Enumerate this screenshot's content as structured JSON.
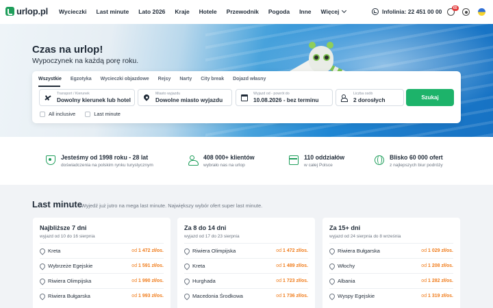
{
  "header": {
    "logo_text": "urlop.pl",
    "nav": [
      "Wycieczki",
      "Last minute",
      "Lato 2026",
      "Kraje",
      "Hotele",
      "Przewodnik",
      "Pogoda",
      "Inne",
      "Więcej"
    ],
    "infolinia": "Infolinia: 22 451 00 00",
    "cart_badge": "65"
  },
  "hero": {
    "title": "Czas na urlop!",
    "subtitle": "Wypoczynek na każdą porę roku."
  },
  "search": {
    "tabs": [
      "Wszystkie",
      "Egzotyka",
      "Wycieczki objazdowe",
      "Rejsy",
      "Narty",
      "City break",
      "Dojazd własny"
    ],
    "fields": [
      {
        "label": "Transport / Kierunek",
        "value": "Dowolny kierunek lub hotel",
        "icon": "plane-icon"
      },
      {
        "label": "Miasto wyjazdu",
        "value": "Dowolne miasto wyjazdu",
        "icon": "pin-icon"
      },
      {
        "label": "Wyjazd od - powrót do",
        "value": "10.08.2026 - bez terminu",
        "icon": "calendar-icon"
      },
      {
        "label": "Liczba osób",
        "value": "2 dorosłych",
        "icon": "people-icon"
      }
    ],
    "button": "Szukaj",
    "checkboxes": [
      "All inclusive",
      "Last minute"
    ]
  },
  "features": [
    {
      "title": "Jesteśmy od 1998 roku - 28 lat",
      "sub": "doświadczenia na polskim rynku turystycznym",
      "icon": "shield-icon"
    },
    {
      "title": "408 000+ klientów",
      "sub": "wybrało nas na urlop",
      "icon": "clients-icon"
    },
    {
      "title": "110 oddziałów",
      "sub": "w całej Polsce",
      "icon": "store-icon"
    },
    {
      "title": "Blisko 60 000 ofert",
      "sub": "z najlepszych biur podróży",
      "icon": "globe-icon"
    }
  ],
  "last_minute": {
    "title": "Last minute",
    "subtitle": "- Wyjedź już jutro na mega last minute. Największy wybór ofert super last minute.",
    "cards": [
      {
        "title": "Najbliższe 7 dni",
        "sub": "wyjazd od 10 do 16 sierpnia",
        "rows": [
          {
            "dest": "Kreta",
            "price_prefix": "od ",
            "price": "1 472 zł/os."
          },
          {
            "dest": "Wybrzeże Egejskie",
            "price_prefix": "od ",
            "price": "1 591 zł/os."
          },
          {
            "dest": "Riwiera Olimpijska",
            "price_prefix": "od ",
            "price": "1 990 zł/os."
          },
          {
            "dest": "Riwiera Bułgarska",
            "price_prefix": "od ",
            "price": "1 993 zł/os."
          }
        ]
      },
      {
        "title": "Za 8 do 14 dni",
        "sub": "wyjazd od 17 do 23 sierpnia",
        "rows": [
          {
            "dest": "Riwiera Olimpijska",
            "price_prefix": "od ",
            "price": "1 472 zł/os."
          },
          {
            "dest": "Kreta",
            "price_prefix": "od ",
            "price": "1 489 zł/os."
          },
          {
            "dest": "Hurghada",
            "price_prefix": "od ",
            "price": "1 723 zł/os."
          },
          {
            "dest": "Macedonia Środkowa",
            "price_prefix": "od ",
            "price": "1 736 zł/os."
          }
        ]
      },
      {
        "title": "Za 15+ dni",
        "sub": "wyjazd od 24 sierpnia do 8 września",
        "rows": [
          {
            "dest": "Riwiera Bułgarska",
            "price_prefix": "od ",
            "price": "1 029 zł/os."
          },
          {
            "dest": "Włochy",
            "price_prefix": "od ",
            "price": "1 208 zł/os."
          },
          {
            "dest": "Albania",
            "price_prefix": "od ",
            "price": "1 282 zł/os."
          },
          {
            "dest": "Wyspy Egejskie",
            "price_prefix": "od ",
            "price": "1 319 zł/os."
          }
        ]
      }
    ]
  }
}
